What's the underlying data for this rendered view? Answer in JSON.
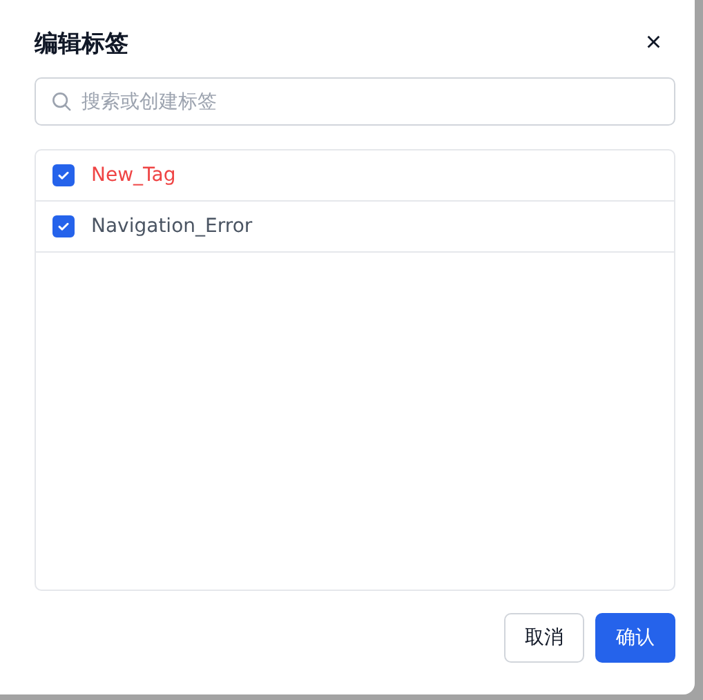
{
  "dialog": {
    "title": "编辑标签",
    "close": "×"
  },
  "search": {
    "placeholder": "搜索或创建标签"
  },
  "tags": [
    {
      "label": "New_Tag",
      "checked": true,
      "color": "#ef4444"
    },
    {
      "label": "Navigation_Error",
      "checked": true,
      "color": "#4b5563"
    }
  ],
  "buttons": [
    {
      "label": "取消",
      "kind": "secondary"
    },
    {
      "label": "确认",
      "kind": "primary"
    }
  ]
}
